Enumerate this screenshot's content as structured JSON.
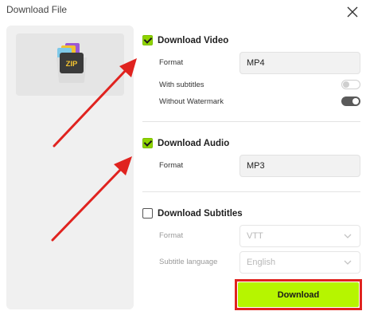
{
  "dialog": {
    "title": "Download File"
  },
  "left_panel": {
    "icon": "zip-file-icon",
    "icon_text": "ZIP"
  },
  "video": {
    "title": "Download Video",
    "checked": true,
    "format_label": "Format",
    "format_value": "MP4",
    "subtitles_label": "With subtitles",
    "subtitles_on": false,
    "watermark_label": "Without Watermark",
    "watermark_on": true
  },
  "audio": {
    "title": "Download Audio",
    "checked": true,
    "format_label": "Format",
    "format_value": "MP3"
  },
  "subtitles": {
    "title": "Download Subtitles",
    "checked": false,
    "format_label": "Format",
    "format_value": "VTT",
    "language_label": "Subtitle language",
    "language_value": "English"
  },
  "actions": {
    "download_label": "Download"
  },
  "colors": {
    "accent": "#b6f500",
    "checkbox": "#8fd400",
    "annotation": "#e0231f"
  }
}
